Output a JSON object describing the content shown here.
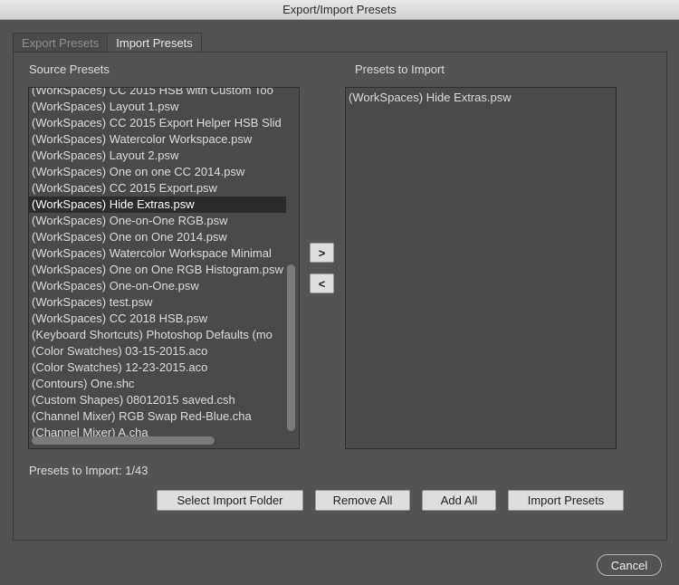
{
  "window": {
    "title": "Export/Import Presets"
  },
  "tabs": [
    {
      "label": "Export Presets"
    },
    {
      "label": "Import Presets"
    }
  ],
  "source": {
    "label": "Source Presets",
    "items": [
      "(WorkSpaces)  CC 2015 HSB with Custom Too",
      "(WorkSpaces)  Layout 1.psw",
      "(WorkSpaces)  CC 2015 Export Helper HSB Slid",
      "(WorkSpaces)  Watercolor Workspace.psw",
      "(WorkSpaces)  Layout 2.psw",
      "(WorkSpaces)  One on one CC 2014.psw",
      "(WorkSpaces)  CC 2015 Export.psw",
      "(WorkSpaces)  Hide Extras.psw",
      "(WorkSpaces)  One-on-One RGB.psw",
      "(WorkSpaces)  One on One 2014.psw",
      "(WorkSpaces)  Watercolor Workspace Minimal",
      "(WorkSpaces)  One on One RGB Histogram.psw",
      "(WorkSpaces)  One-on-One.psw",
      "(WorkSpaces)  test.psw",
      "(WorkSpaces)  CC 2018 HSB.psw",
      "(Keyboard Shortcuts)  Photoshop Defaults (mo",
      "(Color Swatches)  03-15-2015.aco",
      "(Color Swatches)  12-23-2015.aco",
      "(Contours)  One.shc",
      "(Custom Shapes)  08012015 saved.csh",
      "(Channel Mixer)  RGB Swap Red-Blue.cha",
      "(Channel Mixer)  A.cha"
    ],
    "selected_index": 7
  },
  "target": {
    "label": "Presets to Import",
    "items": [
      "(WorkSpaces)  Hide Extras.psw"
    ]
  },
  "move_buttons": {
    "add": ">",
    "remove": "<"
  },
  "count_text": "Presets to Import: 1/43",
  "buttons": {
    "select_folder": "Select Import Folder",
    "remove_all": "Remove All",
    "add_all": "Add All",
    "import": "Import Presets"
  },
  "cancel": "Cancel"
}
